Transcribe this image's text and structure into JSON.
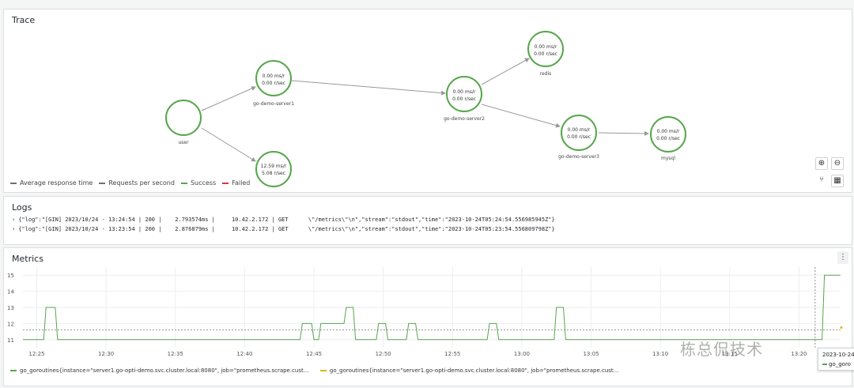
{
  "trace": {
    "title": "Trace",
    "nodes": [
      {
        "id": "user",
        "name": "user",
        "line1": "",
        "line2": ""
      },
      {
        "id": "s1",
        "name": "go-demo-server1",
        "line1": "0.00 ms/r",
        "line2": "0.00 r/sec"
      },
      {
        "id": "s1b",
        "name": "",
        "line1": "12.59 ms/r",
        "line2": "5.08 r/sec"
      },
      {
        "id": "s2",
        "name": "go-demo-server2",
        "line1": "0.00 ms/r",
        "line2": "0.00 r/sec"
      },
      {
        "id": "redis",
        "name": "redis",
        "line1": "0.00 ms/r",
        "line2": "0.00 r/sec"
      },
      {
        "id": "s3",
        "name": "go-demo-server3",
        "line1": "0.00 ms/r",
        "line2": "0.00 r/sec"
      },
      {
        "id": "mysql",
        "name": "mysql",
        "line1": "0.00 ms/r",
        "line2": "0.00 r/sec"
      }
    ],
    "legend": [
      {
        "label": "Average response time",
        "color": "#6e7076"
      },
      {
        "label": "Requests per second",
        "color": "#6e7076"
      },
      {
        "label": "Success",
        "color": "#56a64b"
      },
      {
        "label": "Failed",
        "color": "#e02f44"
      }
    ],
    "node_color": "#56a64b",
    "controls": {
      "zoom_in": "⊕",
      "zoom_out": "⊖",
      "layout": "⑂",
      "grid": "▦"
    }
  },
  "logs": {
    "title": "Logs",
    "lines": [
      "{\"log\":\"[GIN] 2023/10/24 - 13:24:54 | 200 |    2.793574ms |     10.42.2.172 | GET      \\\"/metrics\\\"\\n\",\"stream\":\"stdout\",\"time\":\"2023-10-24T05:24:54.556985945Z\"}",
      "{\"log\":\"[GIN] 2023/10/24 - 13:23:54 | 200 |    2.876879ms |     10.42.2.172 | GET      \\\"/metrics\\\"\\n\",\"stream\":\"stdout\",\"time\":\"2023-10-24T05:23:54.556809798Z\"}"
    ]
  },
  "metrics": {
    "title": "Metrics",
    "menu_icon": "⋮",
    "legend": [
      {
        "label": "go_goroutines{instance=\"server1.go-opti-demo.svc.cluster.local:8080\", job=\"prometheus.scrape.cust...",
        "color": "#56a64b"
      },
      {
        "label": "go_goroutines{instance=\"server1.go-opti-demo.svc.cluster.local:8080\", job=\"prometheus.scrape.cust...",
        "color": "#e0b400"
      }
    ],
    "tooltip": {
      "time": "2023-10-24",
      "series": "go_goro"
    },
    "watermark": "栋总侃技术"
  },
  "chart_data": {
    "type": "line",
    "xlabel": "",
    "ylabel": "",
    "ylim": [
      10.5,
      15.5
    ],
    "yticks": [
      11,
      12,
      13,
      14,
      15
    ],
    "xticks": [
      "12:25",
      "12:30",
      "12:35",
      "12:40",
      "12:45",
      "12:50",
      "12:55",
      "13:00",
      "13:05",
      "13:10",
      "13:15",
      "13:20"
    ],
    "series": [
      {
        "color": "#56a64b",
        "points": [
          [
            "12:24:00",
            11
          ],
          [
            "12:25:30",
            11
          ],
          [
            "12:25:40",
            13
          ],
          [
            "12:26:20",
            13
          ],
          [
            "12:26:30",
            11
          ],
          [
            "12:44:00",
            11
          ],
          [
            "12:44:10",
            12
          ],
          [
            "12:44:50",
            12
          ],
          [
            "12:45:00",
            11
          ],
          [
            "12:45:20",
            11
          ],
          [
            "12:45:30",
            12
          ],
          [
            "12:47:10",
            12
          ],
          [
            "12:47:20",
            13
          ],
          [
            "12:47:50",
            13
          ],
          [
            "12:48:00",
            11
          ],
          [
            "12:49:30",
            11
          ],
          [
            "12:49:40",
            12
          ],
          [
            "12:50:10",
            12
          ],
          [
            "12:50:20",
            11
          ],
          [
            "12:51:40",
            11
          ],
          [
            "12:51:50",
            12
          ],
          [
            "12:52:20",
            12
          ],
          [
            "12:52:30",
            11
          ],
          [
            "12:57:30",
            11
          ],
          [
            "12:57:40",
            12
          ],
          [
            "12:58:10",
            12
          ],
          [
            "12:58:20",
            11
          ],
          [
            "13:02:20",
            11
          ],
          [
            "13:02:30",
            13
          ],
          [
            "13:03:00",
            13
          ],
          [
            "13:03:10",
            11
          ],
          [
            "13:21:40",
            11
          ],
          [
            "13:21:50",
            15
          ],
          [
            "13:23:00",
            15
          ]
        ]
      }
    ],
    "threshold": 11.6,
    "cursor_time": "13:21:10"
  }
}
